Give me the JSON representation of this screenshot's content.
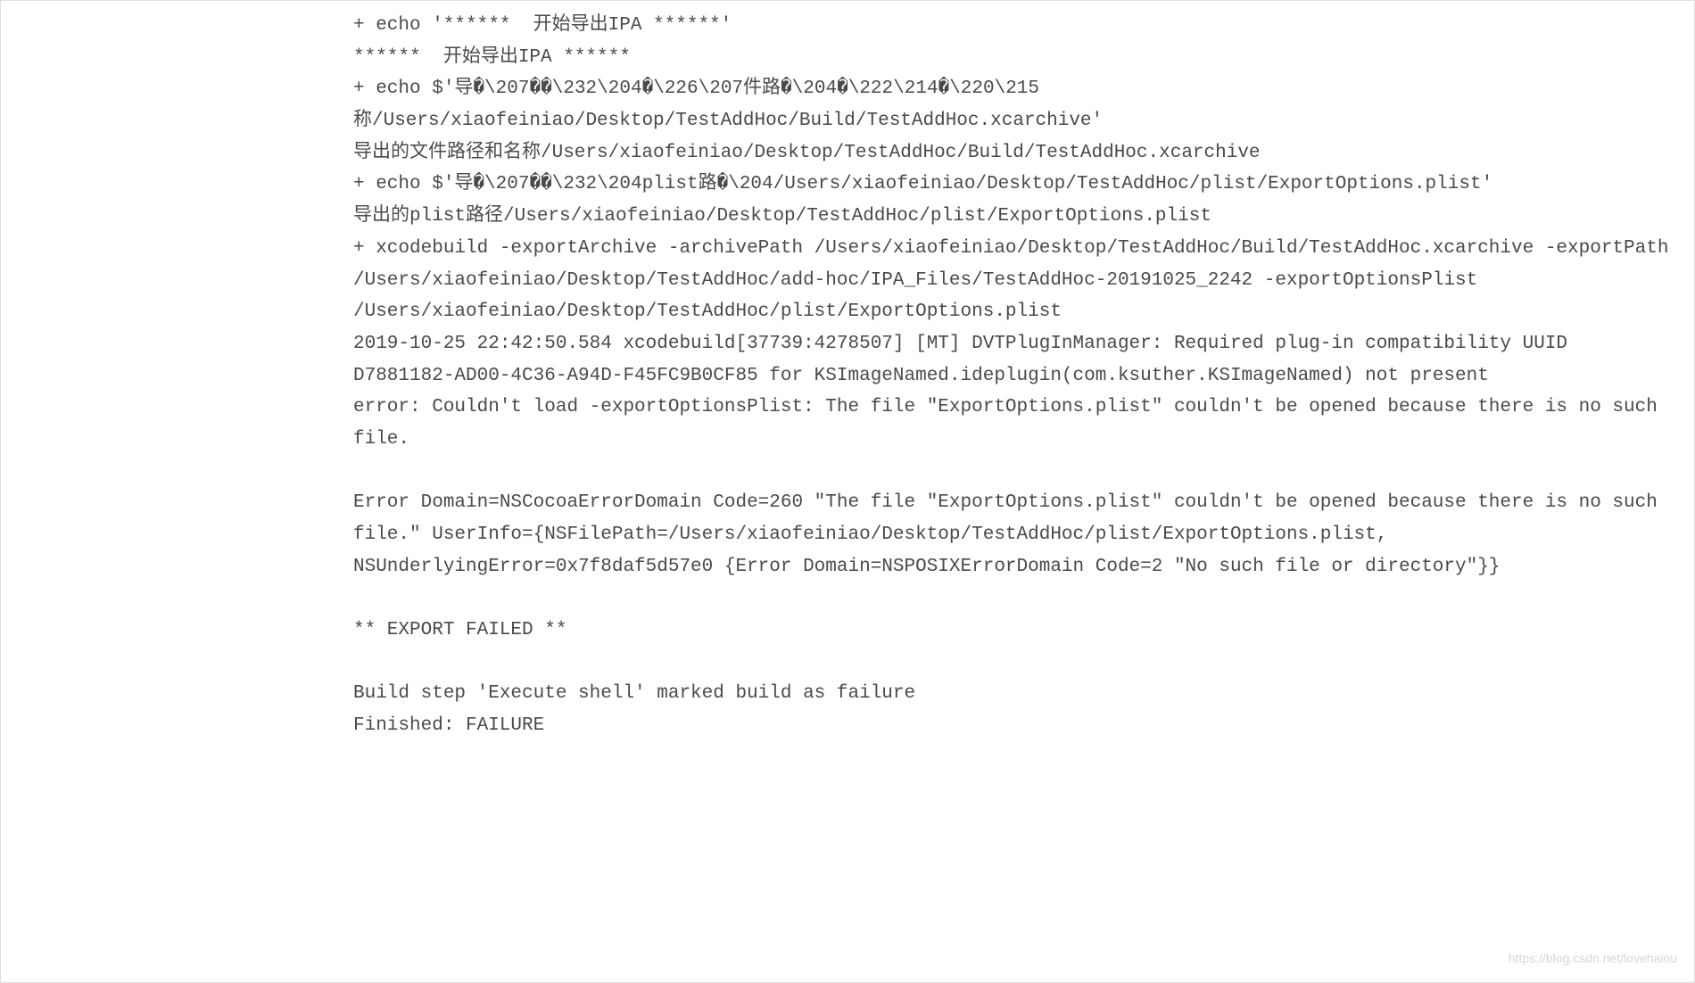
{
  "console": {
    "lines": [
      "+ echo '******  开始导出IPA ******'",
      "******  开始导出IPA ******",
      "+ echo $'导�\\207��\\232\\204�\\226\\207件路�\\204�\\222\\214�\\220\\215称/Users/xiaofeiniao/Desktop/TestAddHoc/Build/TestAddHoc.xcarchive'",
      "导出的文件路径和名称/Users/xiaofeiniao/Desktop/TestAddHoc/Build/TestAddHoc.xcarchive",
      "+ echo $'导�\\207��\\232\\204plist路�\\204/Users/xiaofeiniao/Desktop/TestAddHoc/plist/ExportOptions.plist'",
      "导出的plist路径/Users/xiaofeiniao/Desktop/TestAddHoc/plist/ExportOptions.plist",
      "+ xcodebuild -exportArchive -archivePath /Users/xiaofeiniao/Desktop/TestAddHoc/Build/TestAddHoc.xcarchive -exportPath /Users/xiaofeiniao/Desktop/TestAddHoc/add-hoc/IPA_Files/TestAddHoc-20191025_2242 -exportOptionsPlist /Users/xiaofeiniao/Desktop/TestAddHoc/plist/ExportOptions.plist",
      "2019-10-25 22:42:50.584 xcodebuild[37739:4278507] [MT] DVTPlugInManager: Required plug-in compatibility UUID D7881182-AD00-4C36-A94D-F45FC9B0CF85 for KSImageNamed.ideplugin(com.ksuther.KSImageNamed) not present",
      "error: Couldn't load -exportOptionsPlist: The file \"ExportOptions.plist\" couldn't be opened because there is no such file.",
      "",
      "Error Domain=NSCocoaErrorDomain Code=260 \"The file \"ExportOptions.plist\" couldn't be opened because there is no such file.\" UserInfo={NSFilePath=/Users/xiaofeiniao/Desktop/TestAddHoc/plist/ExportOptions.plist, NSUnderlyingError=0x7f8daf5d57e0 {Error Domain=NSPOSIXErrorDomain Code=2 \"No such file or directory\"}}",
      "",
      "** EXPORT FAILED **",
      "",
      "Build step 'Execute shell' marked build as failure",
      "Finished: FAILURE"
    ]
  },
  "watermark": "https://blog.csdn.net/lovehaiou"
}
